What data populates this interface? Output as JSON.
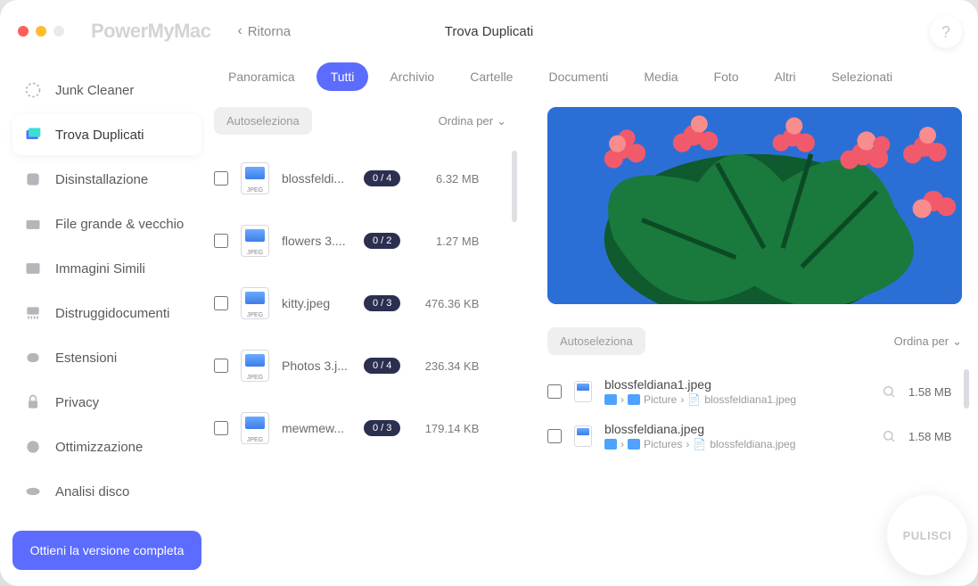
{
  "app_name": "PowerMyMac",
  "back_label": "Ritorna",
  "window_title": "Trova Duplicati",
  "help_label": "?",
  "sidebar": {
    "items": [
      {
        "label": "Junk Cleaner"
      },
      {
        "label": "Trova Duplicati"
      },
      {
        "label": "Disinstallazione"
      },
      {
        "label": "File grande & vecchio"
      },
      {
        "label": "Immagini Simili"
      },
      {
        "label": "Distruggidocumenti"
      },
      {
        "label": "Estensioni"
      },
      {
        "label": "Privacy"
      },
      {
        "label": "Ottimizzazione"
      },
      {
        "label": "Analisi disco"
      }
    ],
    "upgrade": "Ottieni la versione completa"
  },
  "tabs": [
    {
      "label": "Panoramica"
    },
    {
      "label": "Tutti"
    },
    {
      "label": "Archivio"
    },
    {
      "label": "Cartelle"
    },
    {
      "label": "Documenti"
    },
    {
      "label": "Media"
    },
    {
      "label": "Foto"
    },
    {
      "label": "Altri"
    },
    {
      "label": "Selezionati"
    }
  ],
  "autoselect": "Autoseleziona",
  "sort_label": "Ordina per",
  "files": [
    {
      "name": "blossfeldi...",
      "badge": "0 / 4",
      "size": "6.32 MB"
    },
    {
      "name": "flowers 3....",
      "badge": "0 / 2",
      "size": "1.27 MB"
    },
    {
      "name": "kitty.jpeg",
      "badge": "0 / 3",
      "size": "476.36 KB"
    },
    {
      "name": "Photos 3.j...",
      "badge": "0 / 4",
      "size": "236.34 KB"
    },
    {
      "name": "mewmew...",
      "badge": "0 / 3",
      "size": "179.14 KB"
    }
  ],
  "file_ext_label": "JPEG",
  "details": [
    {
      "name": "blossfeldiana1.jpeg",
      "path_parts": [
        "Picture",
        "blossfeldiana1.jpeg"
      ],
      "size": "1.58 MB"
    },
    {
      "name": "blossfeldiana.jpeg",
      "path_parts": [
        "Pictures",
        "blossfeldiana.jpeg"
      ],
      "size": "1.58 MB"
    }
  ],
  "clean_label": "PULISCI"
}
